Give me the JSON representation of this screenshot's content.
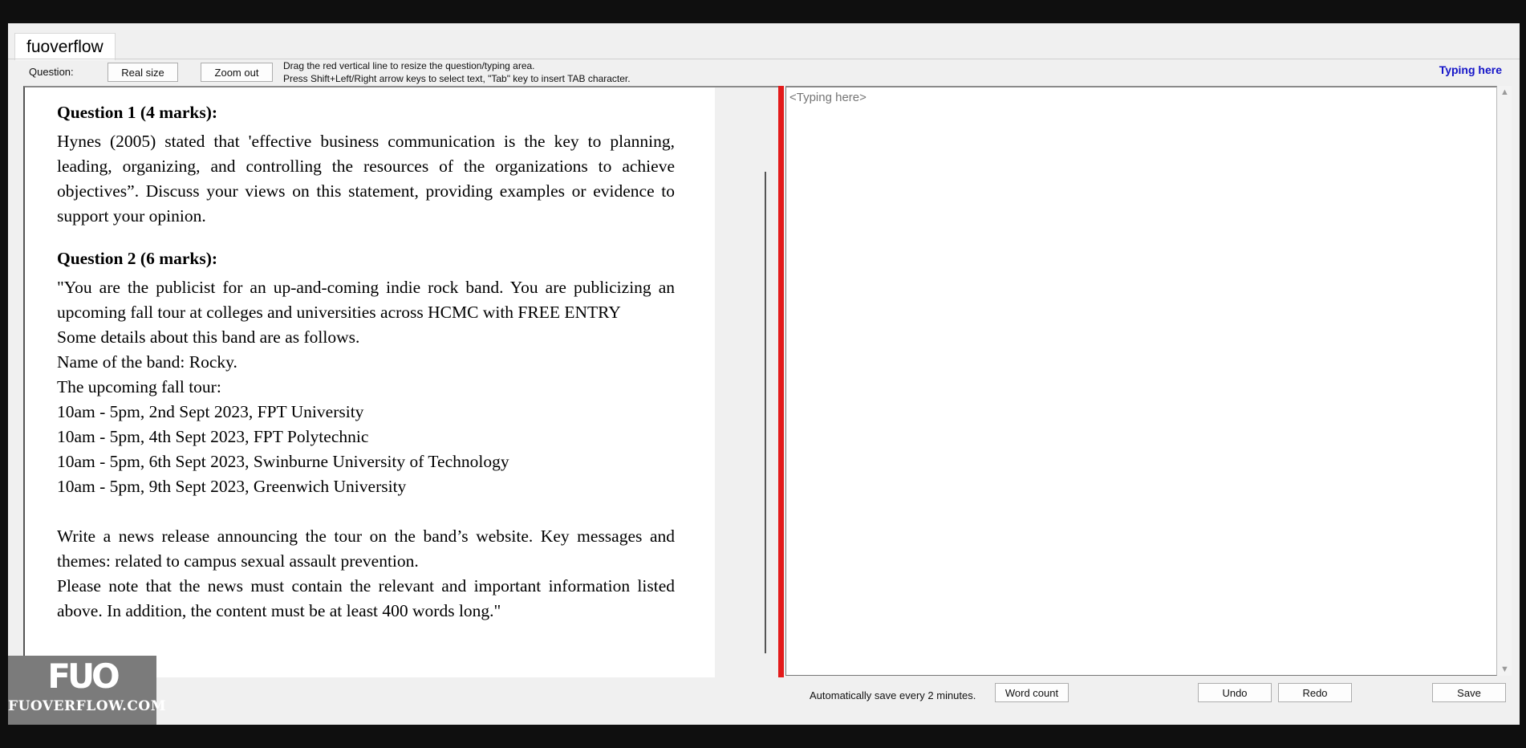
{
  "app": {
    "tab_title": "fuoverflow"
  },
  "toolbar": {
    "question_label": "Question:",
    "real_size_label": "Real size",
    "zoom_out_label": "Zoom out",
    "hint_line1": "Drag the red vertical line to resize the question/typing area.",
    "hint_line2": "Press Shift+Left/Right arrow keys to select text, \"Tab\" key to insert TAB character.",
    "typing_here_link": "Typing here"
  },
  "question": {
    "q1_title": "Question 1 (4 marks):",
    "q1_body": "Hynes (2005) stated that 'effective business communication is the key to planning, leading, organizing, and controlling the resources of the organizations to achieve objectives”. Discuss your views on this statement, providing examples or evidence to support your opinion.",
    "q2_title": "Question 2 (6 marks):",
    "q2_body": "\"You are the publicist for an up-and-coming indie rock band. You are publicizing an upcoming fall tour at colleges and universities across HCMC with FREE ENTRY",
    "q2_lines": [
      "Some details about this band are as follows.",
      "Name of the band: Rocky.",
      "The upcoming fall tour:",
      "10am - 5pm, 2nd Sept 2023, FPT University",
      "10am - 5pm, 4th Sept 2023, FPT Polytechnic",
      "10am - 5pm, 6th Sept 2023, Swinburne University of Technology",
      "10am - 5pm, 9th Sept 2023, Greenwich University"
    ],
    "q2_task1": "Write a news release announcing the tour on the band’s website. Key messages and themes: related to campus sexual assault prevention.",
    "q2_task2": "Please note that the news must contain the relevant and important information listed above. In addition, the content must be at least 400 words long.\""
  },
  "typing": {
    "placeholder": "<Typing here>"
  },
  "bottom": {
    "autosave_text": "Automatically save every 2 minutes.",
    "word_count_label": "Word count",
    "undo_label": "Undo",
    "redo_label": "Redo",
    "save_label": "Save"
  },
  "watermark": {
    "mark": "FUO",
    "site": "FUOVERFLOW.COM"
  },
  "colors": {
    "divider": "#e31a1a",
    "link": "#1414c8"
  }
}
